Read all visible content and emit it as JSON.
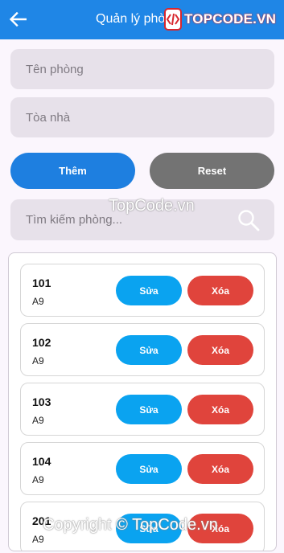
{
  "appbar": {
    "title": "Quản lý phò",
    "back_icon": "arrow-left-icon",
    "background": "#1f86e6"
  },
  "watermark": {
    "logo_text": "TOPCODE.VN",
    "middle_text": "TopCode.vn",
    "bottom_text": "Copyright © TopCode.vn"
  },
  "form": {
    "room_name_placeholder": "Tên phòng",
    "building_placeholder": "Tòa nhà",
    "add_label": "Thêm",
    "reset_label": "Reset"
  },
  "search": {
    "placeholder": "Tìm kiếm phòng...",
    "icon": "search-icon"
  },
  "rooms": [
    {
      "name": "101",
      "building": "A9",
      "edit_label": "Sửa",
      "delete_label": "Xóa"
    },
    {
      "name": "102",
      "building": "A9",
      "edit_label": "Sửa",
      "delete_label": "Xóa"
    },
    {
      "name": "103",
      "building": "A9",
      "edit_label": "Sửa",
      "delete_label": "Xóa"
    },
    {
      "name": "104",
      "building": "A9",
      "edit_label": "Sửa",
      "delete_label": "Xóa"
    },
    {
      "name": "201",
      "building": "A9",
      "edit_label": "Sửa",
      "delete_label": "Xóa"
    }
  ],
  "colors": {
    "primary": "#1e7fe0",
    "secondary": "#737373",
    "edit": "#0aa3f0",
    "delete": "#e0443c"
  }
}
